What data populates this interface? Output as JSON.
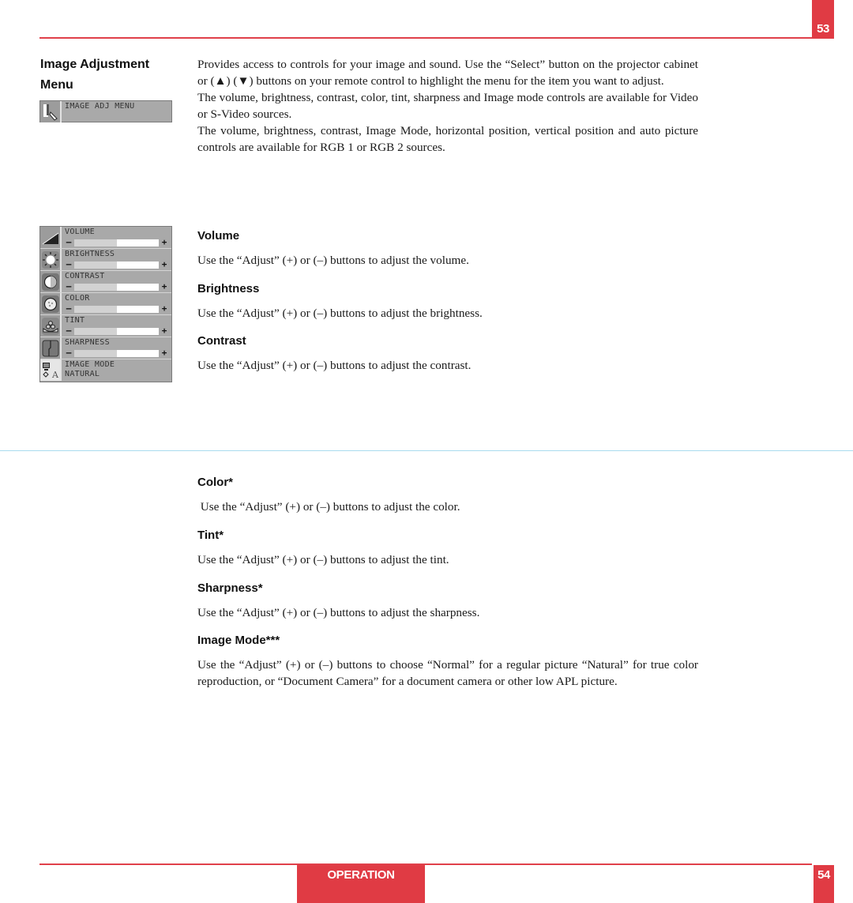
{
  "header": {
    "page_number": "53"
  },
  "footer": {
    "section_label": "OPERATION",
    "page_number": "54"
  },
  "colors": {
    "accent_red": "#e03b44",
    "divider_blue": "#a9dbee",
    "osd_gray": "#a9a9a9"
  },
  "sidebar": {
    "title_line1": "Image Adjustment",
    "title_line2": "Menu",
    "menu_widget": {
      "icon": "hand-pointer-icon",
      "label": "IMAGE ADJ MENU"
    },
    "osd_items": [
      {
        "icon": "volume-ramp-icon",
        "label": "VOLUME",
        "type": "slider",
        "value_percent": 50,
        "minus": "–",
        "plus": "+"
      },
      {
        "icon": "sun-brightness-icon",
        "label": "BRIGHTNESS",
        "type": "slider",
        "value_percent": 50,
        "minus": "–",
        "plus": "+"
      },
      {
        "icon": "contrast-circle-icon",
        "label": "CONTRAST",
        "type": "slider",
        "value_percent": 50,
        "minus": "–",
        "plus": "+"
      },
      {
        "icon": "color-palette-icon",
        "label": "COLOR",
        "type": "slider",
        "value_percent": 50,
        "minus": "–",
        "plus": "+"
      },
      {
        "icon": "tint-icon",
        "label": "TINT",
        "type": "slider",
        "value_percent": 50,
        "minus": "–",
        "plus": "+"
      },
      {
        "icon": "sharpness-icon",
        "label": "SHARPNESS",
        "type": "slider",
        "value_percent": 50,
        "minus": "–",
        "plus": "+"
      },
      {
        "icon": "image-mode-icon",
        "label": "IMAGE MODE",
        "type": "value",
        "value": "NATURAL"
      }
    ]
  },
  "intro": {
    "p1": "Provides access to controls for your image and sound. Use the “Select” button on the projector cabinet or (▲) (▼) buttons on your remote control to highlight the menu for the item you want to adjust.",
    "p2": "The volume, brightness, contrast, color, tint, sharpness and Image mode controls are available for Video or S-Video sources.",
    "p3": "The volume, brightness, contrast, Image Mode, horizontal position, vertical position and auto picture controls are available for RGB 1 or RGB 2 sources."
  },
  "sections": [
    {
      "heading": "Volume",
      "text": "Use the “Adjust” (+) or (–) buttons to adjust the volume."
    },
    {
      "heading": "Brightness",
      "text": "Use the “Adjust” (+) or (–) buttons to adjust the brightness."
    },
    {
      "heading": "Contrast",
      "text": "Use the “Adjust” (+) or (–) buttons to adjust the contrast."
    },
    {
      "heading": "Color*",
      "text": " Use the “Adjust” (+) or (–) buttons to adjust the color."
    },
    {
      "heading": "Tint*",
      "text": "Use the “Adjust” (+) or (–) buttons to adjust the tint."
    },
    {
      "heading": "Sharpness*",
      "text": "Use the “Adjust” (+) or (–) buttons to adjust the sharpness."
    },
    {
      "heading": "Image Mode***",
      "text": "Use the “Adjust” (+) or (–) buttons to choose “Normal” for a regular picture “Natural” for true color reproduction, or “Document Camera” for a document camera or other low APL picture."
    }
  ]
}
